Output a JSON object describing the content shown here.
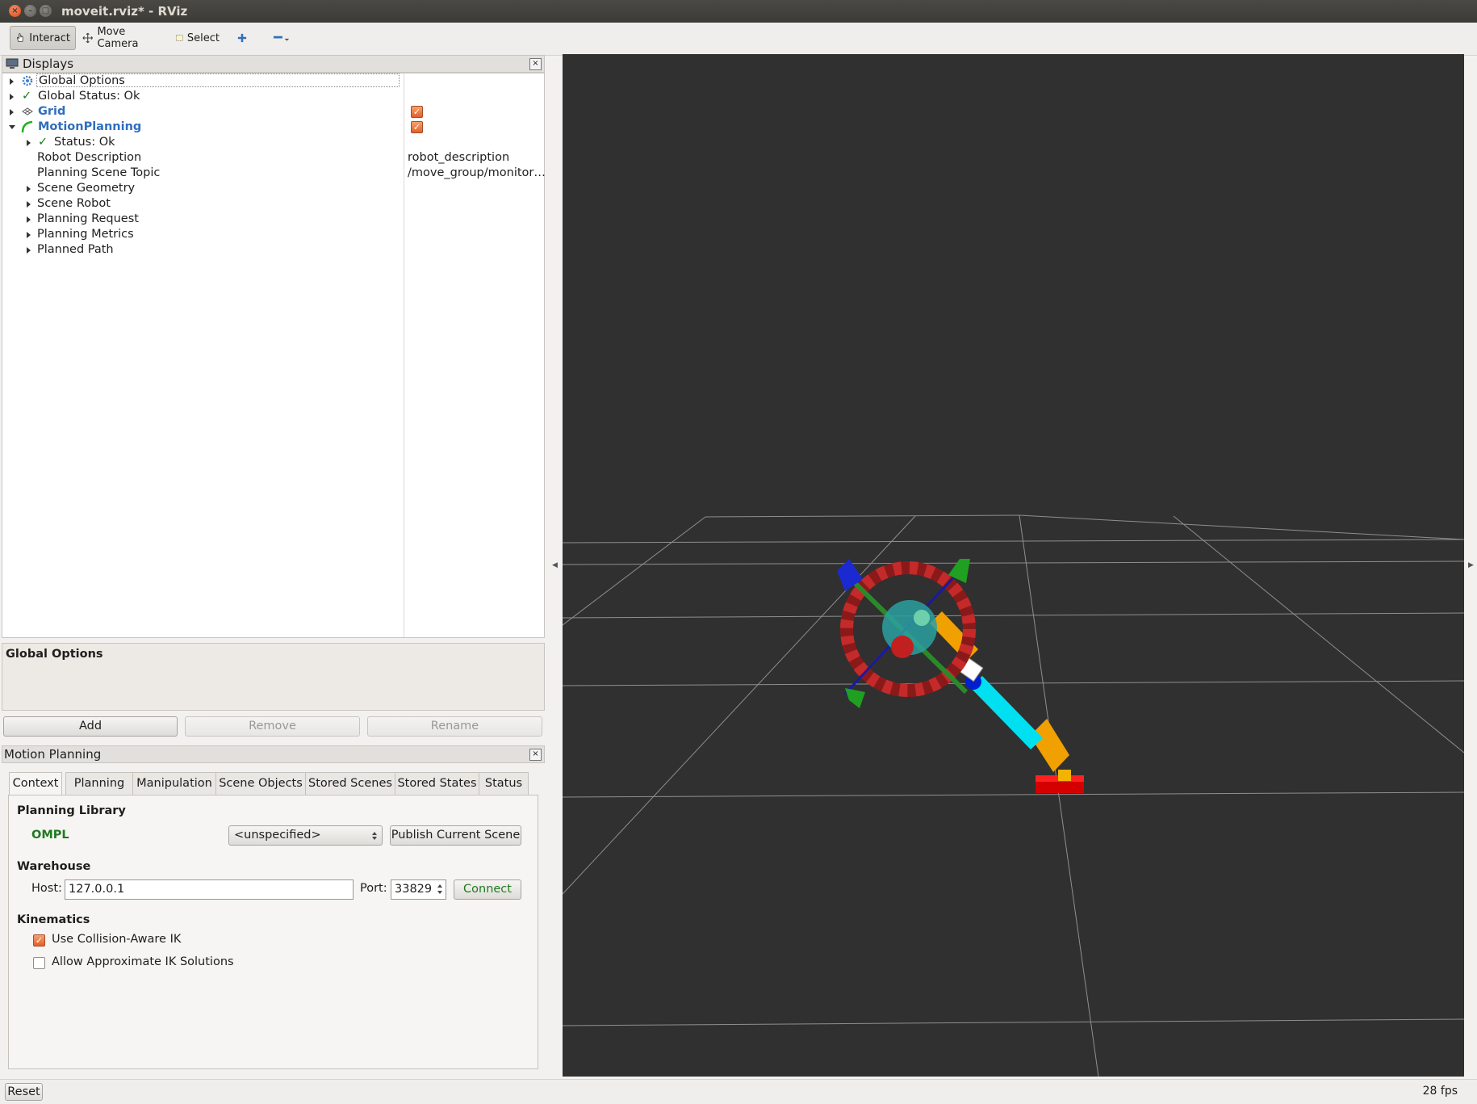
{
  "window": {
    "title": "moveit.rviz* - RViz",
    "buttons": {
      "close": "×",
      "minimize": "–",
      "maximize": "□"
    }
  },
  "toolbar": {
    "interact": "Interact",
    "move_camera": "Move Camera",
    "select": "Select"
  },
  "displays": {
    "title": "Displays",
    "close": "×",
    "rows": {
      "global_options": "Global Options",
      "global_status": "Global Status: Ok",
      "grid": "Grid",
      "motion_planning": "MotionPlanning",
      "status": "Status: Ok",
      "robot_description": {
        "label": "Robot Description",
        "value": "robot_description"
      },
      "planning_scene_topic": {
        "label": "Planning Scene Topic",
        "value": "/move_group/monitor…"
      },
      "scene_geometry": "Scene Geometry",
      "scene_robot": "Scene Robot",
      "planning_request": "Planning Request",
      "planning_metrics": "Planning Metrics",
      "planned_path": "Planned Path"
    },
    "checked": {
      "grid": true,
      "motion_planning": true
    },
    "check_glyph": "✓",
    "description_title": "Global Options",
    "buttons": {
      "add": "Add",
      "remove": "Remove",
      "rename": "Rename"
    }
  },
  "motion_planning": {
    "title": "Motion Planning",
    "close": "×",
    "tabs": [
      "Context",
      "Planning",
      "Manipulation",
      "Scene Objects",
      "Stored Scenes",
      "Stored States",
      "Status"
    ],
    "active_tab": "Context",
    "context": {
      "planning_library_heading": "Planning Library",
      "library_name": "OMPL",
      "planner_select": "<unspecified>",
      "publish_button": "Publish Current Scene",
      "warehouse_heading": "Warehouse",
      "host_label": "Host:",
      "host_value": "127.0.0.1",
      "port_label": "Port:",
      "port_value": "33829",
      "connect_button": "Connect",
      "kinematics_heading": "Kinematics",
      "collision_aware_ik": {
        "label": "Use Collision-Aware IK",
        "checked": true
      },
      "approximate_ik": {
        "label": "Allow Approximate IK Solutions",
        "checked": false
      }
    }
  },
  "statusbar": {
    "reset": "Reset",
    "fps": "28 fps"
  },
  "colors": {
    "accent_orange": "#e2612a",
    "link_blue": "#2f6fbf",
    "ok_green": "#1f7a1f",
    "viewport_bg": "#303030"
  },
  "icons": {
    "interact": "hand-icon",
    "move_camera": "move-camera-icon",
    "select": "select-box-icon",
    "add_tool": "plus-icon",
    "remove_tool": "minus-icon",
    "displays": "monitor-icon"
  }
}
